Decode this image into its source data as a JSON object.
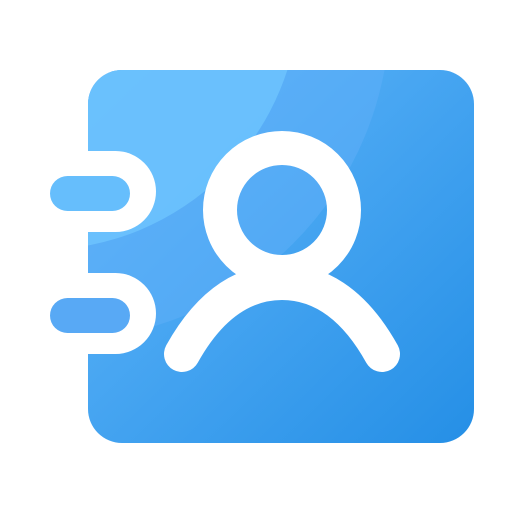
{
  "icon": {
    "name": "address-book-icon",
    "colors": {
      "book_light": "#6ac0fc",
      "book_mid": "#4aa6f4",
      "book_dark": "#2a90e6",
      "tab_top": "#63bdfb",
      "tab_bottom": "#58a9f5",
      "outline": "#ffffff",
      "background": "#ffffff"
    },
    "parts": [
      "book-cover",
      "binder-tab-top",
      "binder-tab-bottom",
      "person-head",
      "person-shoulders"
    ]
  }
}
